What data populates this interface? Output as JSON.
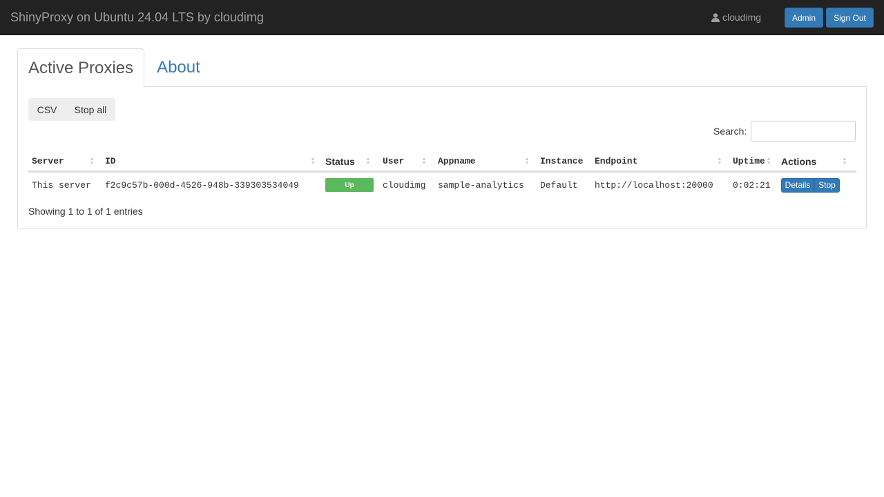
{
  "navbar": {
    "brand": "ShinyProxy on Ubuntu 24.04 LTS by cloudimg",
    "user_icon": "user-icon",
    "username": "cloudimg",
    "admin_label": "Admin",
    "signout_label": "Sign Out"
  },
  "tabs": [
    {
      "label": "Active Proxies",
      "active": true
    },
    {
      "label": "About",
      "active": false
    }
  ],
  "toolbar": {
    "csv_label": "CSV",
    "stop_all_label": "Stop all"
  },
  "search": {
    "label": "Search:",
    "value": "",
    "placeholder": ""
  },
  "table": {
    "headers": {
      "server": "Server",
      "id": "ID",
      "status": "Status",
      "user": "User",
      "appname": "Appname",
      "instance": "Instance",
      "endpoint": "Endpoint",
      "uptime": "Uptime",
      "actions": "Actions"
    },
    "rows": [
      {
        "server": "This server",
        "id": "f2c9c57b-000d-4526-948b-339303534049",
        "status": "Up",
        "user": "cloudimg",
        "appname": "sample-analytics",
        "instance": "Default",
        "endpoint": "http://localhost:20000",
        "uptime": "0:02:21",
        "details_label": "Details",
        "stop_label": "Stop"
      }
    ],
    "info": "Showing 1 to 1 of 1 entries"
  },
  "colors": {
    "navbar_bg": "#222222",
    "primary": "#337ab7",
    "success": "#5cb85c",
    "link": "#337ab7"
  }
}
